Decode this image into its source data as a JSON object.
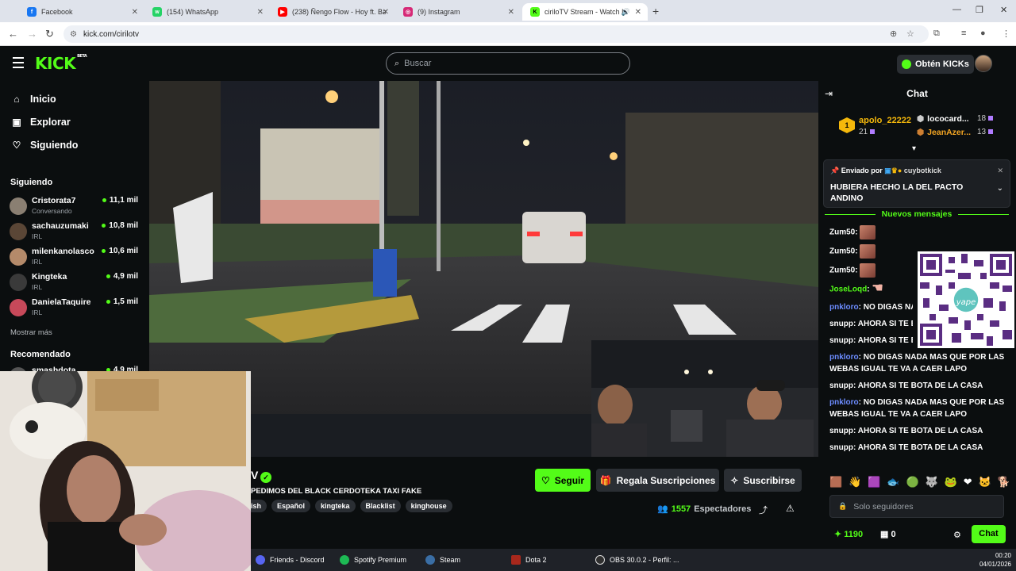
{
  "browser": {
    "tabs": [
      {
        "label": "Facebook",
        "color": "#1877f2",
        "glyph": "f"
      },
      {
        "label": "(154) WhatsApp",
        "color": "#25d366",
        "glyph": "w"
      },
      {
        "label": "(238) Ñengo Flow - Hoy ft. Bad",
        "color": "#ff0000",
        "glyph": "▶"
      },
      {
        "label": "(9) Instagram",
        "color": "#d62976",
        "glyph": "◎"
      },
      {
        "label": "ciriloTV Stream - Watch Live",
        "color": "#53fc18",
        "glyph": "K"
      }
    ],
    "url": "kick.com/cirilotv"
  },
  "header": {
    "logo": "KICK",
    "logo_badge": "BETA",
    "search_placeholder": "Buscar",
    "kicks_label": "Obtén KICKs"
  },
  "sidebar": {
    "nav": [
      {
        "label": "Inicio",
        "icon": "home-icon",
        "glyph": "⌂"
      },
      {
        "label": "Explorar",
        "icon": "browse-icon",
        "glyph": "▣"
      },
      {
        "label": "Siguiendo",
        "icon": "heart-icon",
        "glyph": "♡"
      }
    ],
    "following_title": "Siguiendo",
    "following": [
      {
        "name": "Cristorata7",
        "category": "Conversando",
        "viewers": "11,1 mil",
        "color": "#8a7f72"
      },
      {
        "name": "sachauzumaki",
        "category": "IRL",
        "viewers": "10,8 mil",
        "color": "#5a4636"
      },
      {
        "name": "milenkanolasco",
        "category": "IRL",
        "viewers": "10,6 mil",
        "color": "#b48a6a"
      },
      {
        "name": "Kingteka",
        "category": "IRL",
        "viewers": "4,9 mil",
        "color": "#3a3a3a"
      },
      {
        "name": "DanielaTaquire",
        "category": "IRL",
        "viewers": "1,5 mil",
        "color": "#c7495a"
      }
    ],
    "show_more": "Mostrar más",
    "recommended_title": "Recomendado",
    "recommended_partial": {
      "name": "smashdota",
      "viewers": "4,9 mil"
    }
  },
  "stream": {
    "channel_partial": "V",
    "title": "PEDIMOS DEL BLACK CERDOTEKA TAXI FAKE",
    "tags": [
      "ish",
      "Español",
      "kingteka",
      "Blacklist",
      "kinghouse"
    ],
    "follow_label": "Seguir",
    "gift_label": "Regala Suscripciones",
    "subscribe_label": "Suscribirse",
    "viewers_count": "1557",
    "viewers_label": "Espectadores"
  },
  "chat": {
    "title": "Chat",
    "leaderboard": [
      {
        "user": "apolo_22222",
        "count": "21"
      },
      {
        "user": "lococard...",
        "count": "18"
      },
      {
        "user": "JeanAzer...",
        "count": "13"
      }
    ],
    "pinned_by_label": "Enviado por",
    "pinned_user": "cuybotkick",
    "pinned_message": "HUBIERA HECHO LA DEL PACTO ANDINO",
    "new_messages_label": "Nuevos mensajes",
    "messages": [
      {
        "user": "Zum50",
        "text": "",
        "color": "#ffffff",
        "emote": "face"
      },
      {
        "user": "Zum50",
        "text": "",
        "color": "#ffffff",
        "emote": "face"
      },
      {
        "user": "Zum50",
        "text": "",
        "color": "#ffffff",
        "emote": "face"
      },
      {
        "user": "JoseLoqd",
        "text": "",
        "color": "#53fc18",
        "emote": "hand"
      },
      {
        "user": "pnkloro",
        "text": "NO DIGAS NADA MAS QUE POR LAS WEBAS IGUAL TE VA A CAER LAPO",
        "color": "#6c8cff",
        "emote": ""
      },
      {
        "user": "snupp",
        "text": "AHORA SI TE BOTA DE LA CASA",
        "color": "#ffffff",
        "emote": ""
      },
      {
        "user": "snupp",
        "text": "AHORA SI TE BOTA DE LA CASA",
        "color": "#ffffff",
        "emote": ""
      },
      {
        "user": "pnkloro",
        "text": "NO DIGAS NADA MAS QUE POR LAS WEBAS IGUAL TE VA A CAER LAPO",
        "color": "#6c8cff",
        "emote": ""
      },
      {
        "user": "snupp",
        "text": "AHORA SI TE BOTA DE LA CASA",
        "color": "#ffffff",
        "emote": ""
      },
      {
        "user": "pnkloro",
        "text": "NO DIGAS NADA MAS QUE POR LAS WEBAS IGUAL TE VA A CAER LAPO",
        "color": "#6c8cff",
        "emote": ""
      },
      {
        "user": "snupp",
        "text": "AHORA SI TE BOTA DE LA CASA",
        "color": "#ffffff",
        "emote": ""
      },
      {
        "user": "snupp",
        "text": "AHORA SI TE BOTA DE LA CASA",
        "color": "#ffffff",
        "emote": ""
      }
    ],
    "qr_label": "yape",
    "input_placeholder": "Solo seguidores",
    "points": "1190",
    "gifts": "0",
    "chat_button": "Chat"
  },
  "taskbar": {
    "items": [
      {
        "label": "Friends - Discord",
        "color": "#5865f2"
      },
      {
        "label": "Spotify Premium",
        "color": "#1db954"
      },
      {
        "label": "Steam",
        "color": "#1b2838"
      },
      {
        "label": "Dota 2",
        "color": "#a8281c"
      },
      {
        "label": "OBS 30.0.2 - Perfil: ...",
        "color": "#303030"
      }
    ],
    "time": "00:20",
    "date": "04/01/2026"
  },
  "colors": {
    "accent": "#53fc18",
    "background": "#0b0e0f",
    "surface": "#2a2e33"
  }
}
